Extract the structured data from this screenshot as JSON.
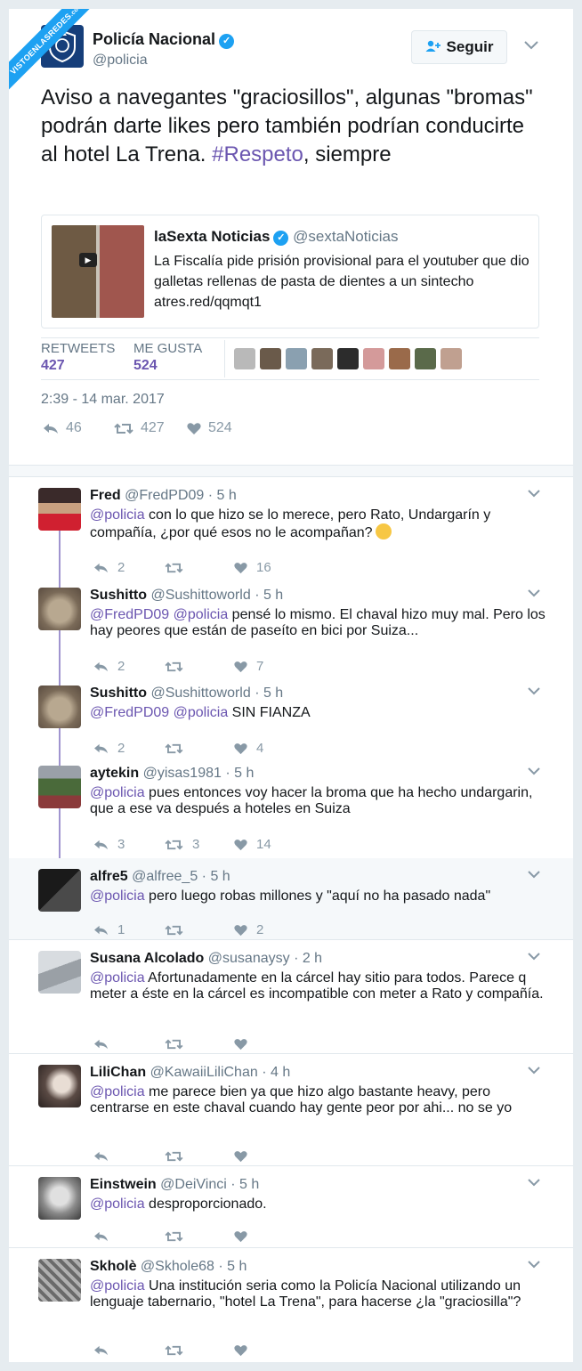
{
  "watermark": {
    "text": "VISTOENLASREDES",
    "suffix": ".com"
  },
  "tweet": {
    "author_name": "Policía Nacional",
    "author_handle": "@policia",
    "follow_label": "Seguir",
    "text_main": "Aviso a navegantes \"graciosillos\", algunas \"bromas\" podrán darte likes pero también podrían conducirte al hotel La Trena. ",
    "hashtag": "#Respeto",
    "text_end": ", siempre",
    "quote": {
      "name": "laSexta Noticias",
      "handle": "@sextaNoticias",
      "text": "La Fiscalía pide prisión provisional para el youtuber que dio galletas rellenas de pasta de dientes a un sintecho atres.red/qqmqt1"
    },
    "retweets_label": "RETWEETS",
    "retweets_count": "427",
    "likes_label": "ME GUSTA",
    "likes_count": "524",
    "timestamp": "2:39 - 14 mar. 2017",
    "actions": {
      "replies": "46",
      "retweets": "427",
      "likes": "524"
    }
  },
  "replies": [
    {
      "name": "Fred",
      "handle": "@FredPD09 · 5 h",
      "mention": "@policia",
      "text": " con lo que hizo se lo merece, pero Rato, Undargarín y compañía, ¿por qué esos no le acompañan?",
      "replies": "2",
      "retweets": "",
      "likes": "16"
    },
    {
      "name": "Sushitto",
      "handle": "@Sushittoworld · 5 h",
      "mention": "@FredPD09 @policia",
      "text": " pensé lo mismo. El chaval hizo muy mal. Pero los hay peores que están de paseíto en bici por Suiza...",
      "replies": "2",
      "retweets": "",
      "likes": "7"
    },
    {
      "name": "Sushitto",
      "handle": "@Sushittoworld · 5 h",
      "mention": "@FredPD09 @policia",
      "text": " SIN FIANZA",
      "replies": "2",
      "retweets": "",
      "likes": "4"
    },
    {
      "name": "aytekin",
      "handle": "@yisas1981 · 5 h",
      "mention": "@policia",
      "text": " pues entonces voy hacer la broma que ha hecho undargarin, que a ese va después a hoteles en Suiza",
      "replies": "3",
      "retweets": "3",
      "likes": "14"
    },
    {
      "name": "alfre5",
      "handle": "@alfree_5 · 5 h",
      "mention": "@policia",
      "text": " pero luego robas millones y \"aquí no ha pasado nada\"",
      "replies": "1",
      "retweets": "",
      "likes": "2"
    },
    {
      "name": "Susana Alcolado",
      "handle": "@susanaysy · 2 h",
      "mention": "@policia",
      "text": " Afortunadamente en la cárcel hay sitio para todos. Parece q meter a éste en la cárcel es incompatible con meter a Rato y compañía.",
      "replies": "",
      "retweets": "",
      "likes": ""
    },
    {
      "name": "LiliChan",
      "handle": "@KawaiiLiliChan · 4 h",
      "mention": "@policia",
      "text": " me parece bien ya que hizo algo bastante heavy, pero centrarse en este chaval cuando hay gente peor por ahi... no se yo",
      "replies": "",
      "retweets": "",
      "likes": ""
    },
    {
      "name": "Einstwein",
      "handle": "@DeiVinci · 5 h",
      "mention": "@policia",
      "text": " desproporcionado.",
      "replies": "",
      "retweets": "",
      "likes": ""
    },
    {
      "name": "Skholè",
      "handle": "@Skhole68 · 5 h",
      "mention": "@policia",
      "text": " Una institución seria como la Policía Nacional utilizando un lenguaje tabernario, \"hotel La Trena\", para hacerse ¿la \"graciosilla\"?",
      "replies": "",
      "retweets": "",
      "likes": ""
    }
  ],
  "icons": {
    "reply": "reply-arrow-icon",
    "retweet": "retweet-icon",
    "like": "heart-icon",
    "verified": "verified-badge-icon",
    "chevron": "chevron-down-icon"
  },
  "colors": {
    "accent": "#1da1f2",
    "link": "#6b56b0",
    "muted": "#657786"
  }
}
